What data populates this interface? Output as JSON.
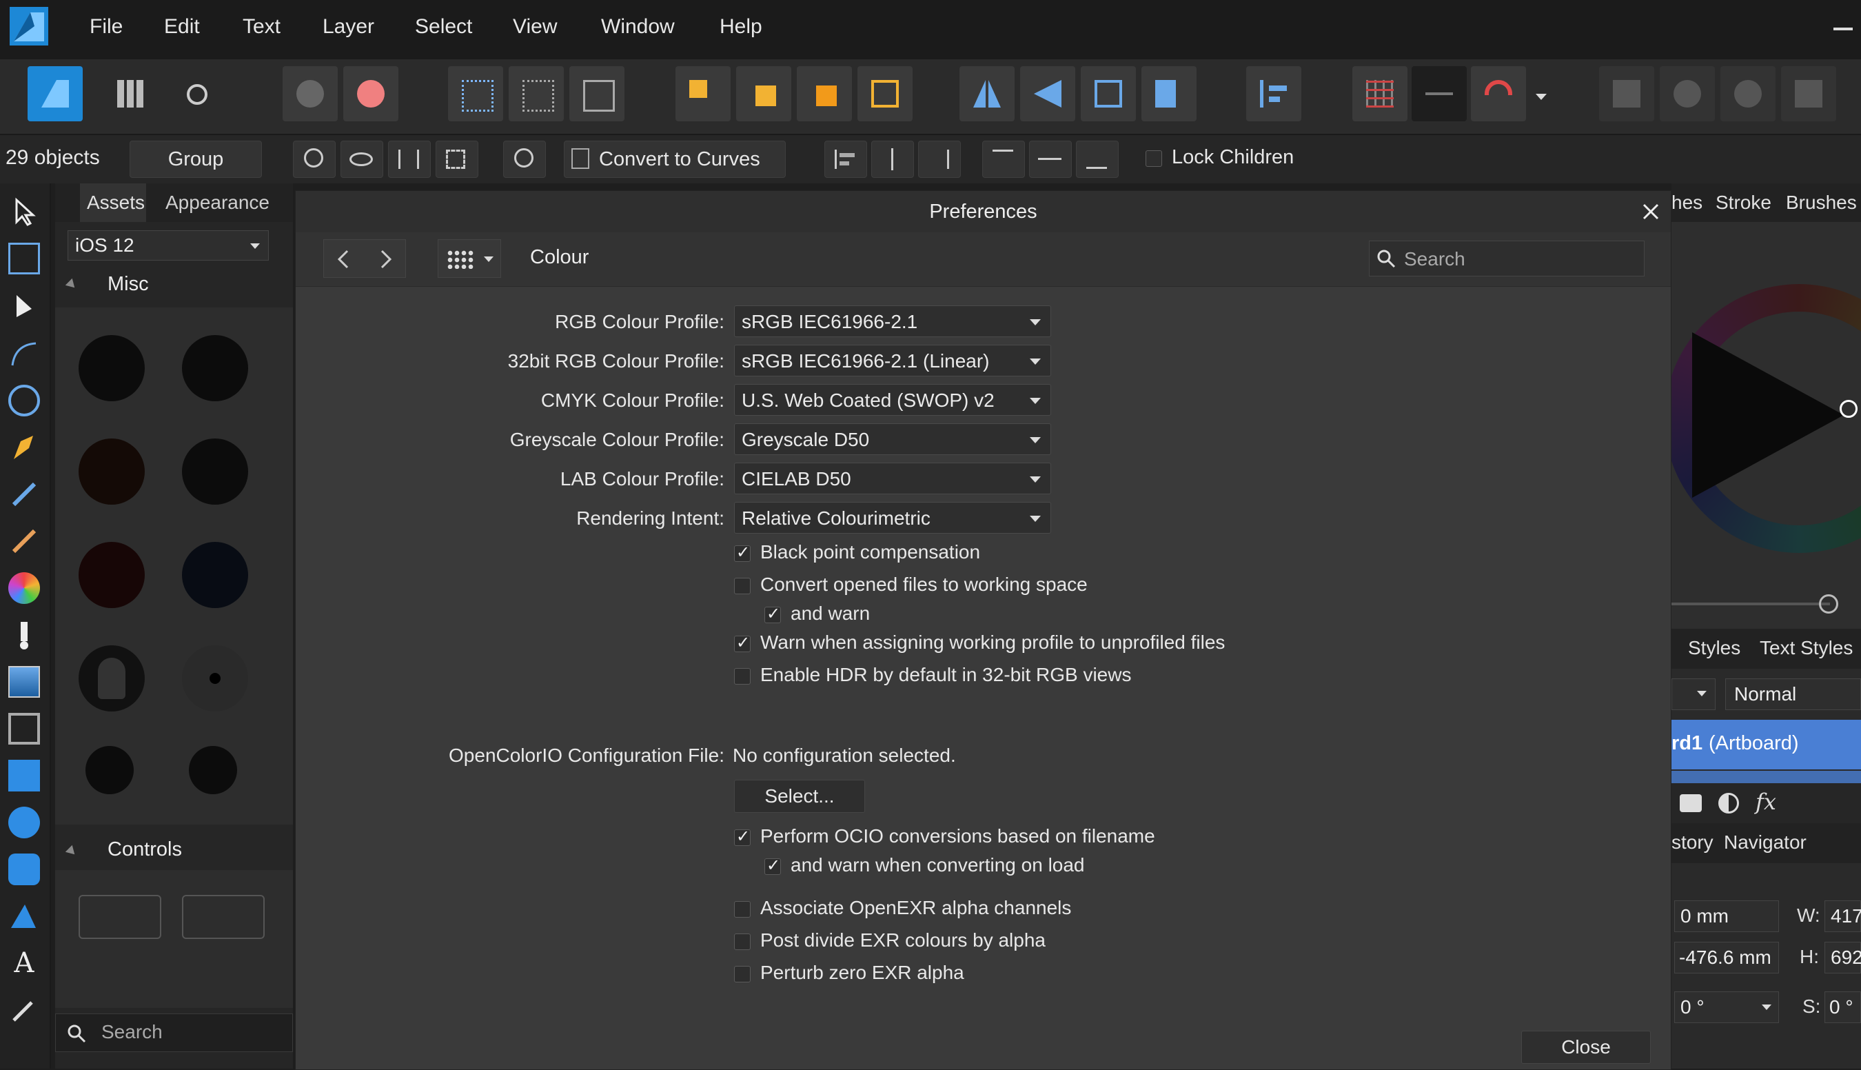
{
  "menubar": {
    "items": [
      "File",
      "Edit",
      "Text",
      "Layer",
      "Select",
      "View",
      "Window",
      "Help"
    ]
  },
  "context": {
    "objects_label": "29 objects",
    "group_label": "Group",
    "convert_label": "Convert to Curves",
    "lock_children_label": "Lock Children"
  },
  "assets": {
    "tab_assets": "Assets",
    "tab_appearance": "Appearance",
    "category_value": "iOS 12",
    "section_misc": "Misc",
    "section_controls": "Controls",
    "search_placeholder": "Search"
  },
  "right_panel": {
    "tab_partial": "hes",
    "tab_stroke": "Stroke",
    "tab_brushes": "Brushes",
    "tab_styles": "Styles",
    "tab_text_styles": "Text Styles",
    "blend_mode": "Normal",
    "layer_bold": "rd1",
    "layer_rest": "(Artboard)",
    "fx_label": "fx",
    "tab_history_partial": "story",
    "tab_navigator": "Navigator",
    "x_value": "0 mm",
    "y_value": "-476.6 mm",
    "w_label": "W:",
    "w_value": "417",
    "h_label": "H:",
    "h_value": "692",
    "r_value": "0 °",
    "s_label": "S:",
    "s_value": "0 °"
  },
  "dialog": {
    "title": "Preferences",
    "section": "Colour",
    "search_placeholder": "Search",
    "profiles": [
      {
        "label": "RGB Colour Profile:",
        "value": "sRGB IEC61966-2.1"
      },
      {
        "label": "32bit RGB Colour Profile:",
        "value": "sRGB IEC61966-2.1 (Linear)"
      },
      {
        "label": "CMYK Colour Profile:",
        "value": "U.S. Web Coated (SWOP) v2"
      },
      {
        "label": "Greyscale Colour Profile:",
        "value": "Greyscale D50"
      },
      {
        "label": "LAB Colour Profile:",
        "value": "CIELAB D50"
      },
      {
        "label": "Rendering Intent:",
        "value": "Relative Colourimetric"
      }
    ],
    "checkboxes": [
      {
        "label": "Black point compensation",
        "checked": true
      },
      {
        "label": "Convert opened files to working space",
        "checked": false
      },
      {
        "label": "and warn",
        "checked": true
      },
      {
        "label": "Warn when assigning working profile to unprofiled files",
        "checked": true
      },
      {
        "label": "Enable HDR by default in 32-bit RGB views",
        "checked": false
      }
    ],
    "ocio_label": "OpenColorIO Configuration File:",
    "ocio_value": "No configuration selected.",
    "select_button": "Select...",
    "ocio_checkboxes": [
      {
        "label": "Perform OCIO conversions based on filename",
        "checked": true
      },
      {
        "label": "and warn when converting on load",
        "checked": true
      },
      {
        "label": "Associate OpenEXR alpha channels",
        "checked": false
      },
      {
        "label": "Post divide EXR colours by alpha",
        "checked": false
      },
      {
        "label": "Perturb zero EXR alpha",
        "checked": false
      }
    ],
    "close_button": "Close"
  },
  "colors": {
    "accent": "#1d88d6",
    "layer_highlight": "#4a7fd4"
  }
}
